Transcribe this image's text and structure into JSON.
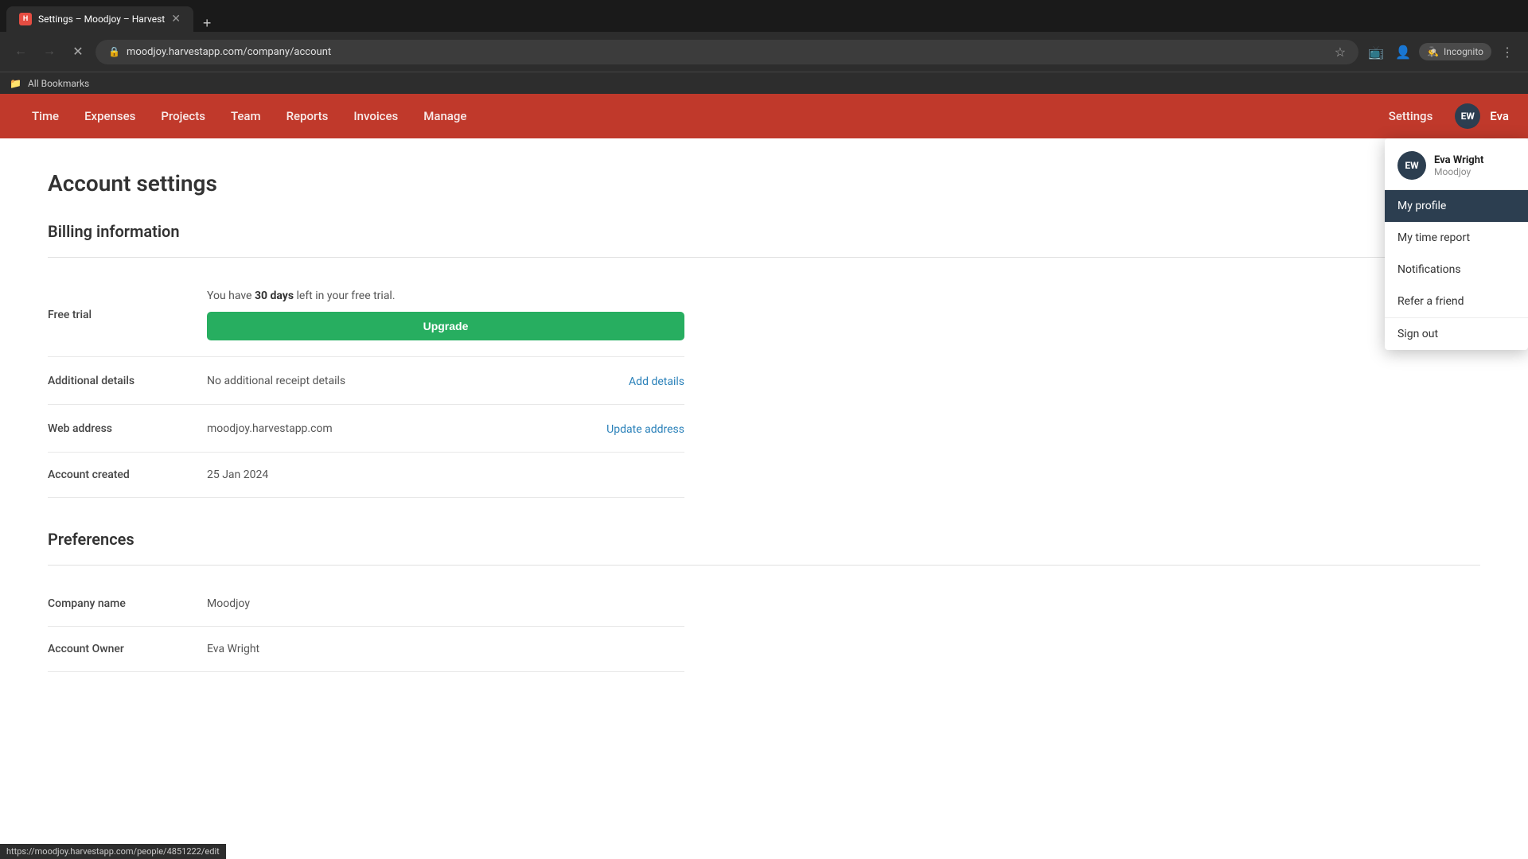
{
  "browser": {
    "tab": {
      "title": "Settings – Moodjoy – Harvest",
      "favicon": "H"
    },
    "address": "moodjoy.harvestapp.com/company/account",
    "incognito_label": "Incognito",
    "bookmarks_label": "All Bookmarks"
  },
  "nav": {
    "items": [
      {
        "id": "time",
        "label": "Time"
      },
      {
        "id": "expenses",
        "label": "Expenses"
      },
      {
        "id": "projects",
        "label": "Projects"
      },
      {
        "id": "team",
        "label": "Team"
      },
      {
        "id": "reports",
        "label": "Reports"
      },
      {
        "id": "invoices",
        "label": "Invoices"
      },
      {
        "id": "manage",
        "label": "Manage"
      }
    ],
    "settings_label": "Settings",
    "user_initials": "EW",
    "user_name": "Eva"
  },
  "dropdown": {
    "user_initials": "EW",
    "user_name": "Eva Wright",
    "user_org": "Moodjoy",
    "items": [
      {
        "id": "my-profile",
        "label": "My profile",
        "active": true
      },
      {
        "id": "my-time-report",
        "label": "My time report",
        "active": false
      },
      {
        "id": "notifications",
        "label": "Notifications",
        "active": false
      },
      {
        "id": "refer-a-friend",
        "label": "Refer a friend",
        "active": false
      },
      {
        "id": "sign-out",
        "label": "Sign out",
        "active": false
      }
    ]
  },
  "page": {
    "title": "Account settings",
    "billing_section": "Billing information",
    "rows": [
      {
        "id": "free-trial",
        "label": "Free trial",
        "value_prefix": "You have ",
        "value_bold": "30 days",
        "value_suffix": " left in your free trial.",
        "button": "Upgrade"
      },
      {
        "id": "additional-details",
        "label": "Additional details",
        "value": "No additional receipt details",
        "action_label": "Add details"
      },
      {
        "id": "web-address",
        "label": "Web address",
        "value": "moodjoy.harvestapp.com",
        "action_label": "Update address"
      },
      {
        "id": "account-created",
        "label": "Account created",
        "value": "25 Jan 2024"
      }
    ],
    "preferences_section": "Preferences",
    "preferences_rows": [
      {
        "id": "company-name",
        "label": "Company name",
        "value": "Moodjoy"
      },
      {
        "id": "account-owner",
        "label": "Account Owner",
        "value": "Eva Wright"
      }
    ]
  },
  "status_bar": {
    "url": "https://moodjoy.harvestapp.com/people/4851222/edit"
  }
}
